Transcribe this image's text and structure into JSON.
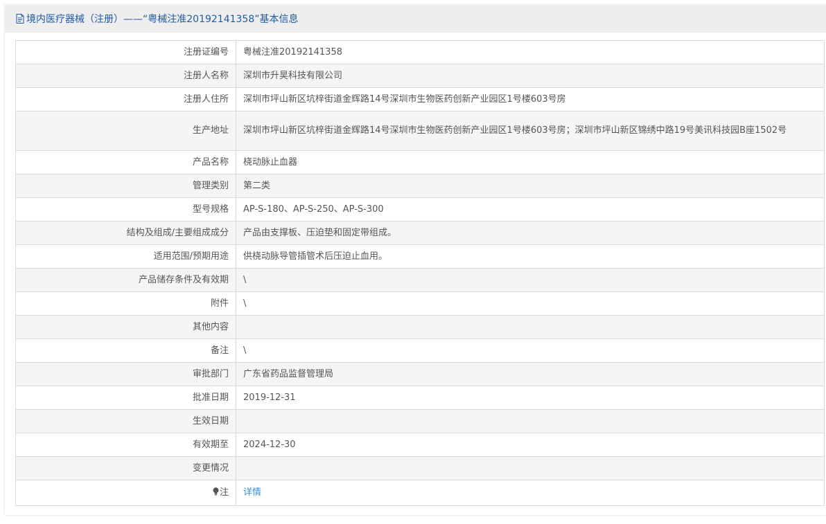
{
  "header": {
    "title": "境内医疗器械（注册）——“粤械注准20192141358”基本信息",
    "icon": "document-icon",
    "title_color": "#1e5aa8"
  },
  "rows": [
    {
      "label": "注册证编号",
      "value": "粤械注准20192141358"
    },
    {
      "label": "注册人名称",
      "value": "深圳市升昊科技有限公司"
    },
    {
      "label": "注册人住所",
      "value": "深圳市坪山新区坑梓街道金辉路14号深圳市生物医药创新产业园区1号楼603号房"
    },
    {
      "label": "生产地址",
      "value": "深圳市坪山新区坑梓街道金辉路14号深圳市生物医药创新产业园区1号楼603号房；深圳市坪山新区锦绣中路19号美讯科技园B座1502号"
    },
    {
      "label": "产品名称",
      "value": "桡动脉止血器"
    },
    {
      "label": "管理类别",
      "value": "第二类"
    },
    {
      "label": "型号规格",
      "value": "AP-S-180、AP-S-250、AP-S-300"
    },
    {
      "label": "结构及组成/主要组成成分",
      "value": "产品由支撑板、压迫垫和固定带组成。"
    },
    {
      "label": "适用范围/预期用途",
      "value": "供桡动脉导管插管术后压迫止血用。"
    },
    {
      "label": "产品储存条件及有效期",
      "value": "\\"
    },
    {
      "label": "附件",
      "value": "\\"
    },
    {
      "label": "其他内容",
      "value": ""
    },
    {
      "label": "备注",
      "value": "\\"
    },
    {
      "label": "审批部门",
      "value": "广东省药品监督管理局"
    },
    {
      "label": "批准日期",
      "value": "2019-12-31"
    },
    {
      "label": "生效日期",
      "value": ""
    },
    {
      "label": "有效期至",
      "value": "2024-12-30"
    },
    {
      "label": "变更情况",
      "value": ""
    }
  ],
  "note": {
    "label": "注",
    "icon": "lightbulb-icon",
    "link_text": "详情",
    "link_color": "#3c8ed6"
  }
}
